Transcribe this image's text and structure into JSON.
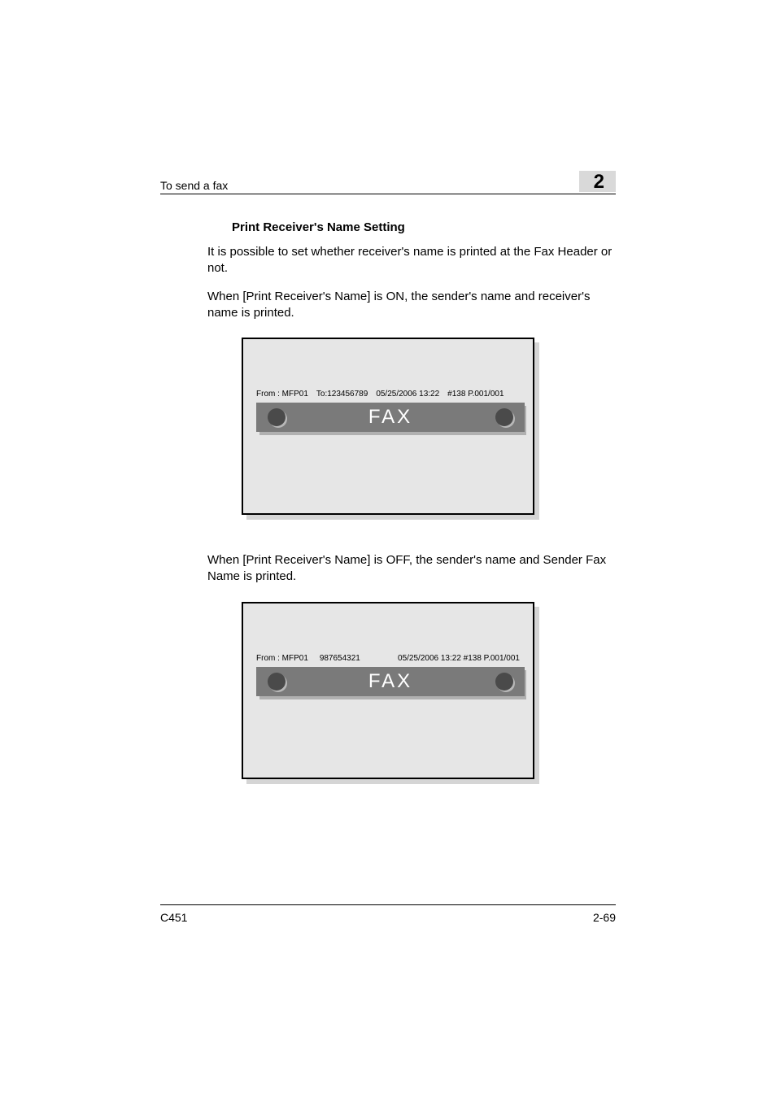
{
  "header": {
    "title": "To send a fax",
    "chapter": "2"
  },
  "section": {
    "title": "Print Receiver's Name Setting",
    "intro": "It is possible to set whether receiver's name is printed at the Fax Header or not.",
    "on_text": "When [Print Receiver's Name] is ON, the sender's name and receiver's name is printed.",
    "off_text": "When [Print Receiver's Name] is OFF, the sender's name and Sender Fax Name is printed."
  },
  "diagram1": {
    "from": "From : MFP01",
    "to": "To:123456789",
    "datetime": "05/25/2006 13:22",
    "meta": "#138 P.001/001",
    "label": "FAX"
  },
  "diagram2": {
    "from": "From : MFP01",
    "sender": "987654321",
    "right": "05/25/2006 13:22 #138 P.001/001",
    "label": "FAX"
  },
  "footer": {
    "model": "C451",
    "page": "2-69"
  }
}
